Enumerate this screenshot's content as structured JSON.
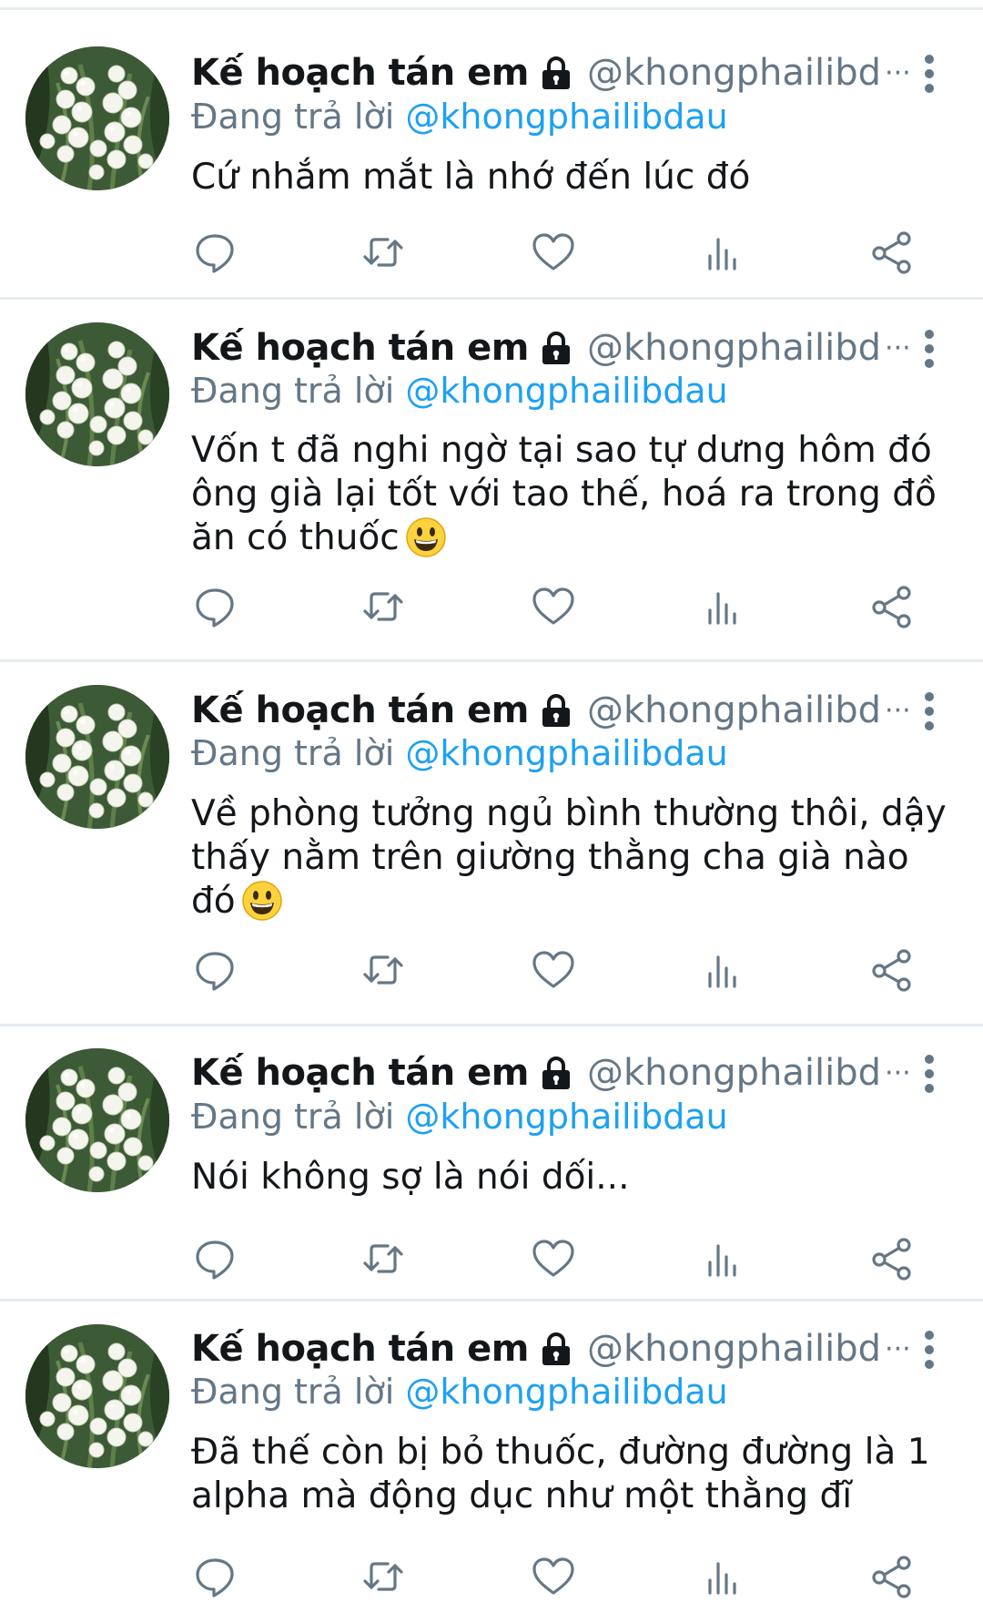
{
  "tweets": [
    {
      "display_name": "Kế hoạch tán em",
      "handle": "@khongphailibd",
      "replying_prefix": "Đang trả lời ",
      "replying_to": "@khongphailibdau",
      "text": "Cứ nhắm mắt là nhớ đến lúc đó",
      "emoji": ""
    },
    {
      "display_name": "Kế hoạch tán em",
      "handle": "@khongphailibd",
      "replying_prefix": "Đang trả lời ",
      "replying_to": "@khongphailibdau",
      "text": "Vốn t đã nghi ngờ tại sao tự dưng hôm đó ông già lại tốt với tao thế, hoá ra trong đồ ăn có thuốc",
      "emoji": "grinning-face-emoji"
    },
    {
      "display_name": "Kế hoạch tán em",
      "handle": "@khongphailibd",
      "replying_prefix": "Đang trả lời ",
      "replying_to": "@khongphailibdau",
      "text": "Về phòng tưởng ngủ bình thường thôi, dậy thấy nằm trên giường thằng cha già nào đó",
      "emoji": "grinning-face-emoji"
    },
    {
      "display_name": "Kế hoạch tán em",
      "handle": "@khongphailibd",
      "replying_prefix": "Đang trả lời ",
      "replying_to": "@khongphailibdau",
      "text": "Nói không sợ là nói dối...",
      "emoji": ""
    },
    {
      "display_name": "Kế hoạch tán em",
      "handle": "@khongphailibd",
      "replying_prefix": "Đang trả lời ",
      "replying_to": "@khongphailibdau",
      "text": "Đã thế còn bị bỏ thuốc, đường đường là 1 alpha mà động dục như một thằng đĩ",
      "emoji": ""
    }
  ],
  "handle_ellipsis": "···",
  "icons": {
    "lock": "lock-icon",
    "more": "more-vertical-icon",
    "reply": "reply-icon",
    "retweet": "retweet-icon",
    "like": "heart-icon",
    "analytics": "analytics-icon",
    "share": "share-icon"
  },
  "colors": {
    "text": "#14171a",
    "secondary": "#657786",
    "link": "#1da1f2",
    "divider": "#e6ecf0"
  }
}
